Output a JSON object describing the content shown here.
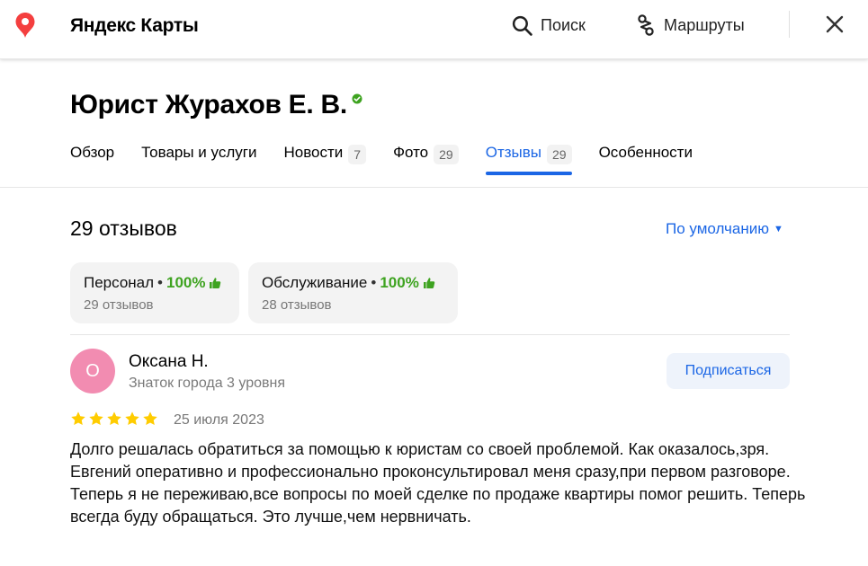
{
  "header": {
    "brand": "Яндекс Карты",
    "search_label": "Поиск",
    "routes_label": "Маршруты",
    "accent_color": "#1b66e5",
    "logo_color": "#f43f3f"
  },
  "org": {
    "title": "Юрист Журахов Е. В."
  },
  "tabs": [
    {
      "label": "Обзор",
      "count": ""
    },
    {
      "label": "Товары и услуги",
      "count": ""
    },
    {
      "label": "Новости",
      "count": "7"
    },
    {
      "label": "Фото",
      "count": "29"
    },
    {
      "label": "Отзывы",
      "count": "29",
      "active": true
    },
    {
      "label": "Особенности",
      "count": ""
    }
  ],
  "reviews": {
    "count_label": "29 отзывов",
    "sort_label": "По умолчанию",
    "aspects": [
      {
        "name": "Персонал",
        "percent": "100%",
        "sub": "29 отзывов"
      },
      {
        "name": "Обслуживание",
        "percent": "100%",
        "sub": "28 отзывов"
      }
    ],
    "items": [
      {
        "avatar_letter": "О",
        "avatar_color": "#f28cb1",
        "author": "Оксана Н.",
        "level": "Знаток города 3 уровня",
        "subscribe_label": "Подписаться",
        "rating": 5,
        "date": "25 июля 2023",
        "text": "Долго решалась обратиться за помощью к юристам со своей проблемой. Как оказалось,зря. Евгений оперативно и профессионально проконсультировал меня сразу,при первом разговоре. Теперь я не переживаю,все вопросы по моей сделке по продаже квартиры помог решить. Теперь всегда буду обращаться. Это лучше,чем нервничать."
      }
    ]
  }
}
